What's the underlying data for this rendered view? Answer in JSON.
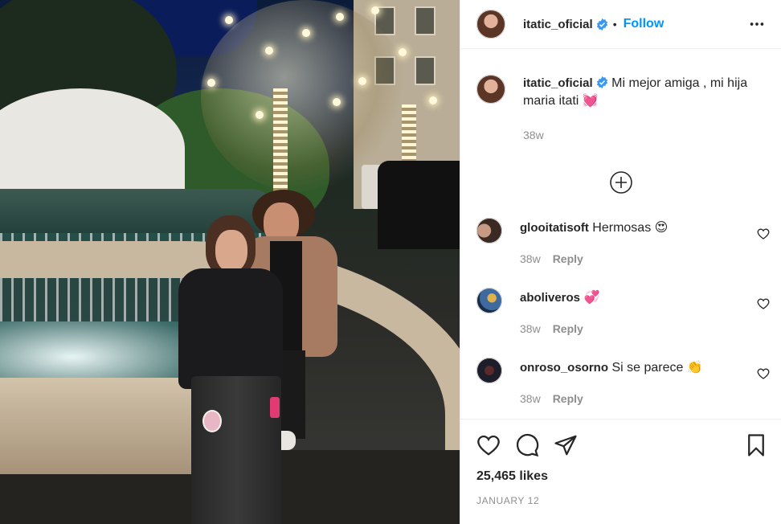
{
  "post": {
    "author": "itatic_oficial",
    "follow_label": "Follow",
    "separator": "•",
    "caption": {
      "username": "itatic_oficial",
      "text": "Mi mejor amiga , mi hija maria itati 💓",
      "age": "38w"
    },
    "comments": [
      {
        "username": "glooitatisoft",
        "text": "Hermosas 😍",
        "age": "38w",
        "reply_label": "Reply"
      },
      {
        "username": "aboliveros",
        "text": "💞",
        "age": "38w",
        "reply_label": "Reply"
      },
      {
        "username": "onroso_osorno",
        "text": "Si se parece 👏",
        "age": "38w",
        "reply_label": "Reply"
      }
    ],
    "likes": "25,465 likes",
    "date": "January 12"
  },
  "icons": {
    "verified": "verified-badge-icon",
    "more": "more-options-icon",
    "load_more": "load-more-comments-icon",
    "comment_like": "heart-icon",
    "like": "heart-icon",
    "comment": "comment-icon",
    "share": "share-icon",
    "save": "bookmark-icon"
  },
  "colors": {
    "accent": "#0095f6",
    "verified": "#3897f0",
    "muted": "#8e8e8e",
    "text": "#262626"
  }
}
